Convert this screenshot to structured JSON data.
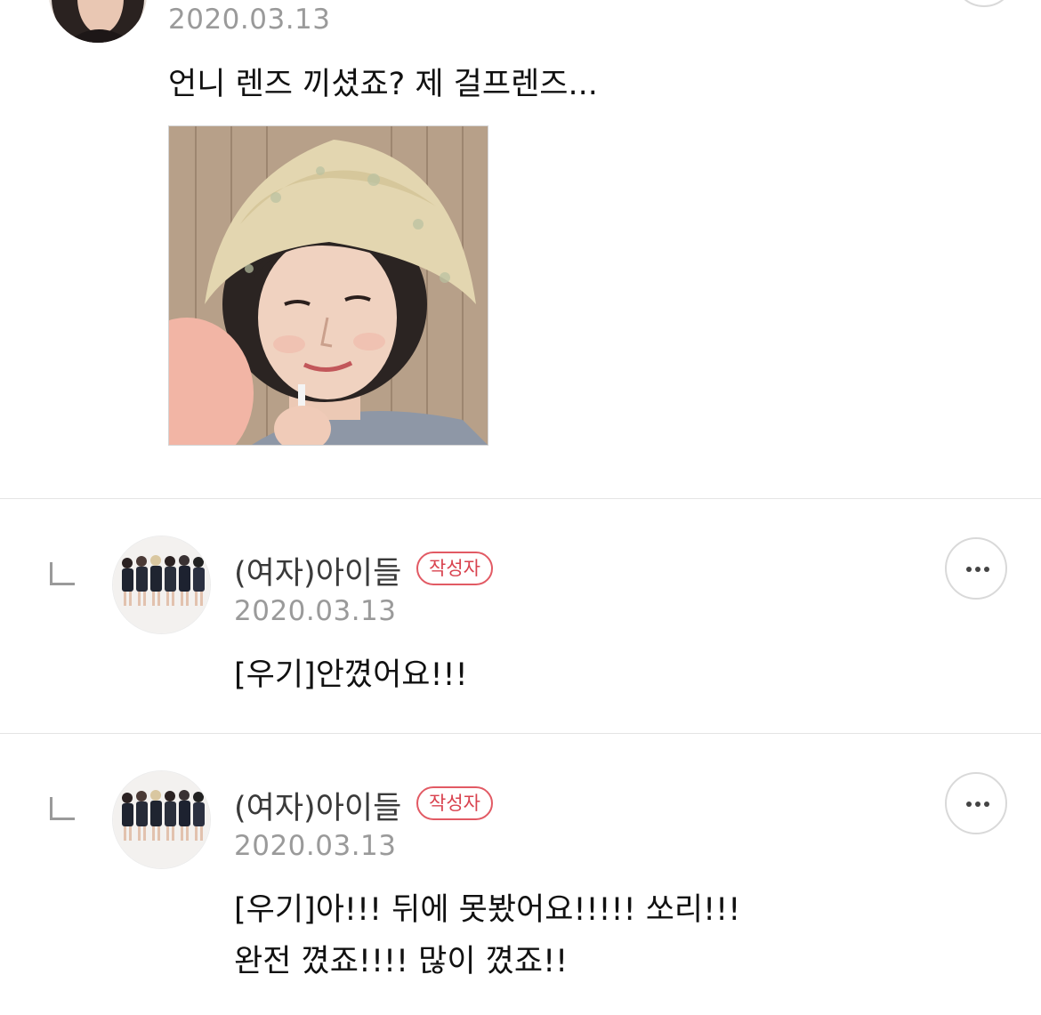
{
  "comments": [
    {
      "date": "2020.03.13",
      "text": "언니 렌즈 끼셨죠? 제 걸프렌즈...",
      "image": "woman-in-bucket-hat-photo"
    },
    {
      "nickname": "(여자)아이들",
      "badge": "작성자",
      "date": "2020.03.13",
      "text": "[우기]안꼈어요!!!",
      "avatar": "group-photo-avatar"
    },
    {
      "nickname": "(여자)아이들",
      "badge": "작성자",
      "date": "2020.03.13",
      "lines": [
        "[우기]아!!! 뒤에 못봤어요!!!!! 쏘리!!!",
        "완전 꼈죠!!!! 많이 꼈죠!!"
      ],
      "avatar": "group-photo-avatar"
    }
  ],
  "icons": {
    "more": "more-icon",
    "reply": "reply-arrow-icon"
  },
  "colors": {
    "badge": "#d9434f",
    "date": "#9a9a9a",
    "divider": "#e4e4e4"
  }
}
